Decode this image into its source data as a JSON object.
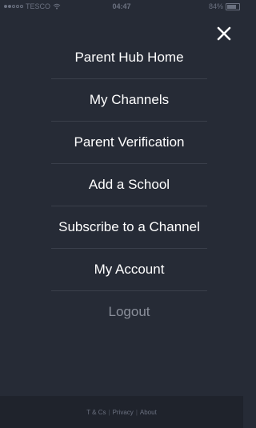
{
  "status_bar": {
    "carrier": "TESCO",
    "time": "04:47",
    "battery": "84%"
  },
  "menu": {
    "items": [
      {
        "label": "Parent Hub Home"
      },
      {
        "label": "My Channels"
      },
      {
        "label": "Parent Verification"
      },
      {
        "label": "Add a School"
      },
      {
        "label": "Subscribe to a Channel"
      },
      {
        "label": "My Account"
      },
      {
        "label": "Logout"
      }
    ]
  },
  "footer": {
    "links": [
      "T & Cs",
      "Privacy",
      "About"
    ],
    "separator": "|"
  },
  "colors": {
    "background": "#262b36",
    "footer_background": "#1f232c",
    "text": "#ffffff",
    "muted_text": "#8a8f9a"
  },
  "icons": {
    "close": "close-icon",
    "wifi": "wifi-icon",
    "battery": "battery-icon"
  }
}
